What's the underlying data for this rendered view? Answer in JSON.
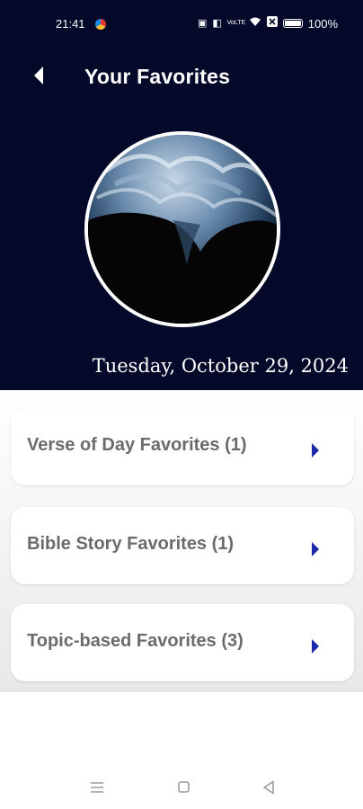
{
  "status_bar": {
    "time": "21:41",
    "icons": [
      "nfc-icon",
      "vibrate-icon",
      "volte-icon",
      "wifi-icon",
      "close-box-icon",
      "battery-icon"
    ],
    "volte_text": "VoLTE",
    "battery_percent": "100%"
  },
  "header": {
    "title": "Your Favorites",
    "date": "Tuesday, October 29, 2024",
    "background_color": "#04092a"
  },
  "favorites": [
    {
      "label": "Verse of Day Favorites (1)"
    },
    {
      "label": "Bible Story Favorites (1)"
    },
    {
      "label": "Topic-based Favorites (3)"
    }
  ],
  "colors": {
    "accent_arrow": "#1a2aa8",
    "card_text": "#6b6b6b"
  },
  "nav_bar": {
    "icons": [
      "menu-icon",
      "home-icon",
      "back-icon"
    ]
  }
}
